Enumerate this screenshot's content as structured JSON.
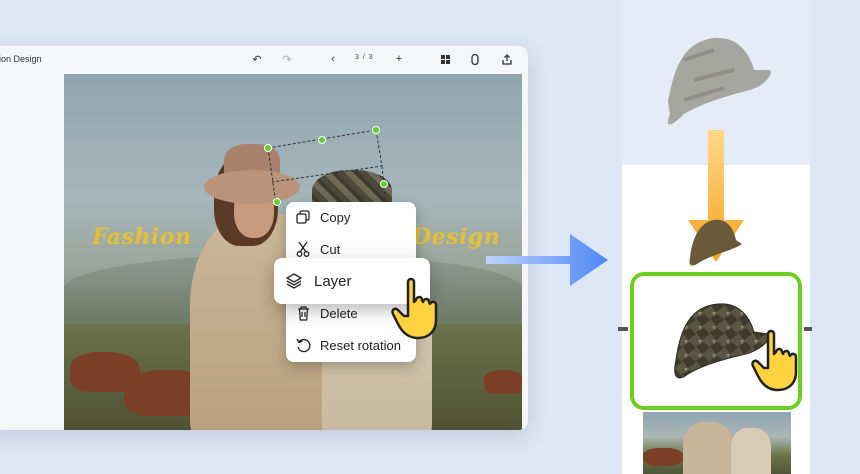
{
  "window": {
    "title": "hion Design",
    "page_indicator": "3 / 3"
  },
  "toolbar": {
    "undo_icon": "undo-icon",
    "redo_icon": "redo-icon",
    "prev_icon": "chevron-left-icon",
    "add_icon": "plus-icon",
    "grid_icon": "grid-icon",
    "attach_icon": "paperclip-icon",
    "share_icon": "share-icon"
  },
  "canvas": {
    "text_left": "Fashion",
    "text_right": "Design",
    "text_color": "#e8c033",
    "selection_color": "#5ed12a"
  },
  "context_menu": {
    "items": [
      {
        "label": "Copy",
        "icon": "copy-icon"
      },
      {
        "label": "Cut",
        "icon": "scissors-icon"
      },
      {
        "label": "Layer",
        "icon": "layers-icon"
      },
      {
        "label": "Delete",
        "icon": "trash-icon"
      },
      {
        "label": "Reset rotation",
        "icon": "rotate-icon"
      }
    ]
  },
  "colors": {
    "background": "#dde6f4",
    "highlight": "#6ccf1f",
    "arrow_blue": "#5a8ef5",
    "arrow_orange": "#f2b233",
    "pointer": "#ffd23f"
  }
}
